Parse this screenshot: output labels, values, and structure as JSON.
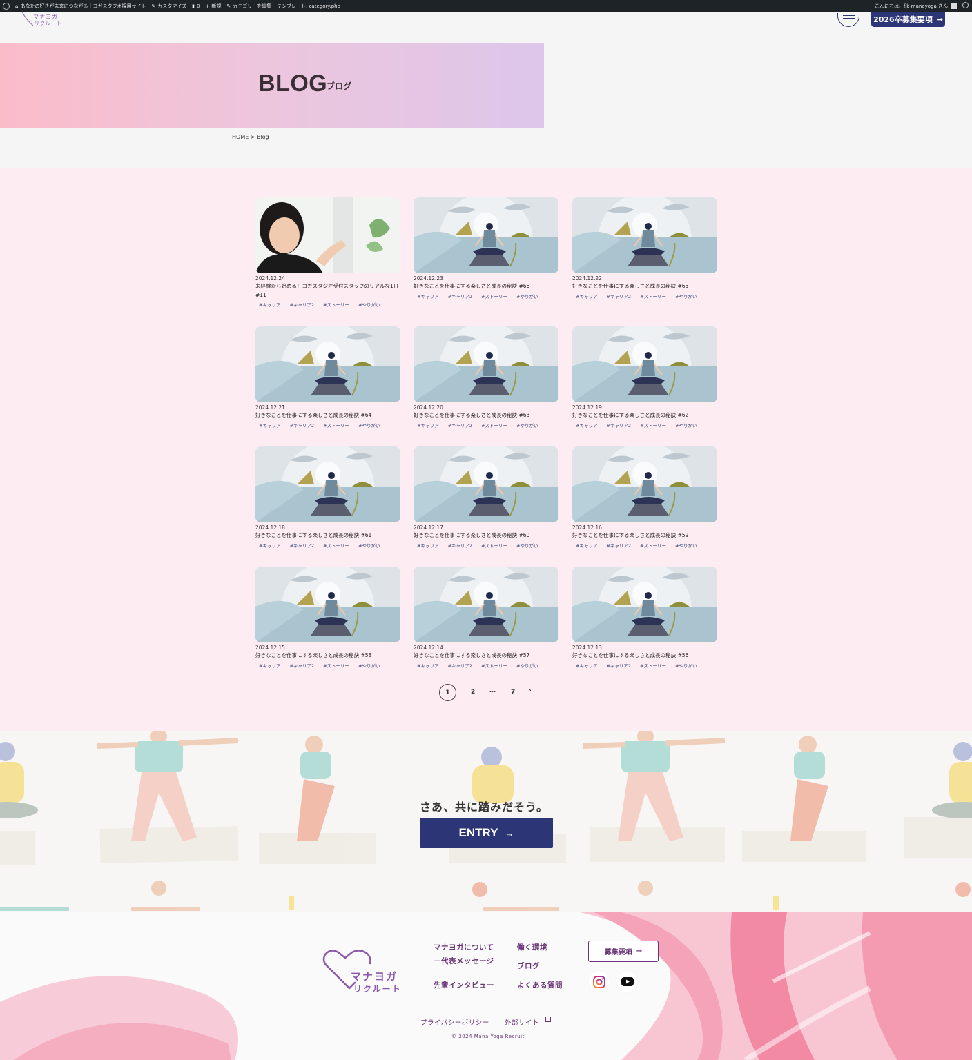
{
  "admin_bar": {
    "site_name": "あなたの好きが未来につながる｜ヨガスタジオ採用サイト",
    "customize": "カスタマイズ",
    "comments_count": "0",
    "new": "新規",
    "edit_category": "カテゴリーを編集",
    "template": "テンプレート: category.php",
    "greeting": "こんにちは、f.k-manayoga さん"
  },
  "header": {
    "logo_text_1": "マナヨガ",
    "logo_text_2": "リクルート",
    "recruit_button": "2026卒募集要項",
    "recruit_arrow": "→"
  },
  "hero": {
    "title": "BLOG",
    "subtitle": "ブログ"
  },
  "breadcrumb": "HOME > Blog",
  "posts": [
    {
      "date": "2024.12.24",
      "title": "未経験から始める！ヨガスタジオ受付スタッフのリアルな1日#11",
      "thumb": "staff-photo",
      "tags": [
        "#キャリア",
        "#キャリア2",
        "#ストーリー",
        "#やりがい"
      ]
    },
    {
      "date": "2024.12.23",
      "title": "好きなことを仕事にする楽しさと成長の秘訣 #66",
      "thumb": "yoga-illustration",
      "tags": [
        "#キャリア",
        "#キャリア2",
        "#ストーリー",
        "#やりがい"
      ]
    },
    {
      "date": "2024.12.22",
      "title": "好きなことを仕事にする楽しさと成長の秘訣 #65",
      "thumb": "yoga-illustration",
      "tags": [
        "#キャリア",
        "#キャリア2",
        "#ストーリー",
        "#やりがい"
      ]
    },
    {
      "date": "2024.12.21",
      "title": "好きなことを仕事にする楽しさと成長の秘訣 #64",
      "thumb": "yoga-illustration",
      "tags": [
        "#キャリア",
        "#キャリア2",
        "#ストーリー",
        "#やりがい"
      ]
    },
    {
      "date": "2024.12.20",
      "title": "好きなことを仕事にする楽しさと成長の秘訣 #63",
      "thumb": "yoga-illustration",
      "tags": [
        "#キャリア",
        "#キャリア2",
        "#ストーリー",
        "#やりがい"
      ]
    },
    {
      "date": "2024.12.19",
      "title": "好きなことを仕事にする楽しさと成長の秘訣 #62",
      "thumb": "yoga-illustration",
      "tags": [
        "#キャリア",
        "#キャリア2",
        "#ストーリー",
        "#やりがい"
      ]
    },
    {
      "date": "2024.12.18",
      "title": "好きなことを仕事にする楽しさと成長の秘訣 #61",
      "thumb": "yoga-illustration",
      "tags": [
        "#キャリア",
        "#キャリア2",
        "#ストーリー",
        "#やりがい"
      ]
    },
    {
      "date": "2024.12.17",
      "title": "好きなことを仕事にする楽しさと成長の秘訣 #60",
      "thumb": "yoga-illustration",
      "tags": [
        "#キャリア",
        "#キャリア2",
        "#ストーリー",
        "#やりがい"
      ]
    },
    {
      "date": "2024.12.16",
      "title": "好きなことを仕事にする楽しさと成長の秘訣 #59",
      "thumb": "yoga-illustration",
      "tags": [
        "#キャリア",
        "#キャリア2",
        "#ストーリー",
        "#やりがい"
      ]
    },
    {
      "date": "2024.12.15",
      "title": "好きなことを仕事にする楽しさと成長の秘訣 #58",
      "thumb": "yoga-illustration",
      "tags": [
        "#キャリア",
        "#キャリア2",
        "#ストーリー",
        "#やりがい"
      ]
    },
    {
      "date": "2024.12.14",
      "title": "好きなことを仕事にする楽しさと成長の秘訣 #57",
      "thumb": "yoga-illustration",
      "tags": [
        "#キャリア",
        "#キャリア2",
        "#ストーリー",
        "#やりがい"
      ]
    },
    {
      "date": "2024.12.13",
      "title": "好きなことを仕事にする楽しさと成長の秘訣 #56",
      "thumb": "yoga-illustration",
      "tags": [
        "#キャリア",
        "#キャリア2",
        "#ストーリー",
        "#やりがい"
      ]
    }
  ],
  "pagination": {
    "current": "1",
    "page2": "2",
    "ellipsis": "…",
    "last": "7",
    "next": "›"
  },
  "cta": {
    "text": "さあ、共に踏みだそう。",
    "button": "ENTRY",
    "button_arrow": "→"
  },
  "footer": {
    "logo_text_1": "マナヨガ",
    "logo_text_2": "リクルート",
    "links": {
      "about": "マナヨガについて",
      "message": "－代表メッセージ",
      "interview": "先輩インタビュー",
      "environment": "働く環境",
      "blog": "ブログ",
      "faq": "よくある質問"
    },
    "recruit_button": "募集要項",
    "recruit_arrow": "→",
    "privacy": "プライバシーポリシー",
    "external": "外部サイト",
    "copyright": "© 2024 Mana Yoga Recruit",
    "colors": {
      "accent": "#6a3478",
      "navy": "#2c3677",
      "pink": "#f06a8c"
    }
  }
}
